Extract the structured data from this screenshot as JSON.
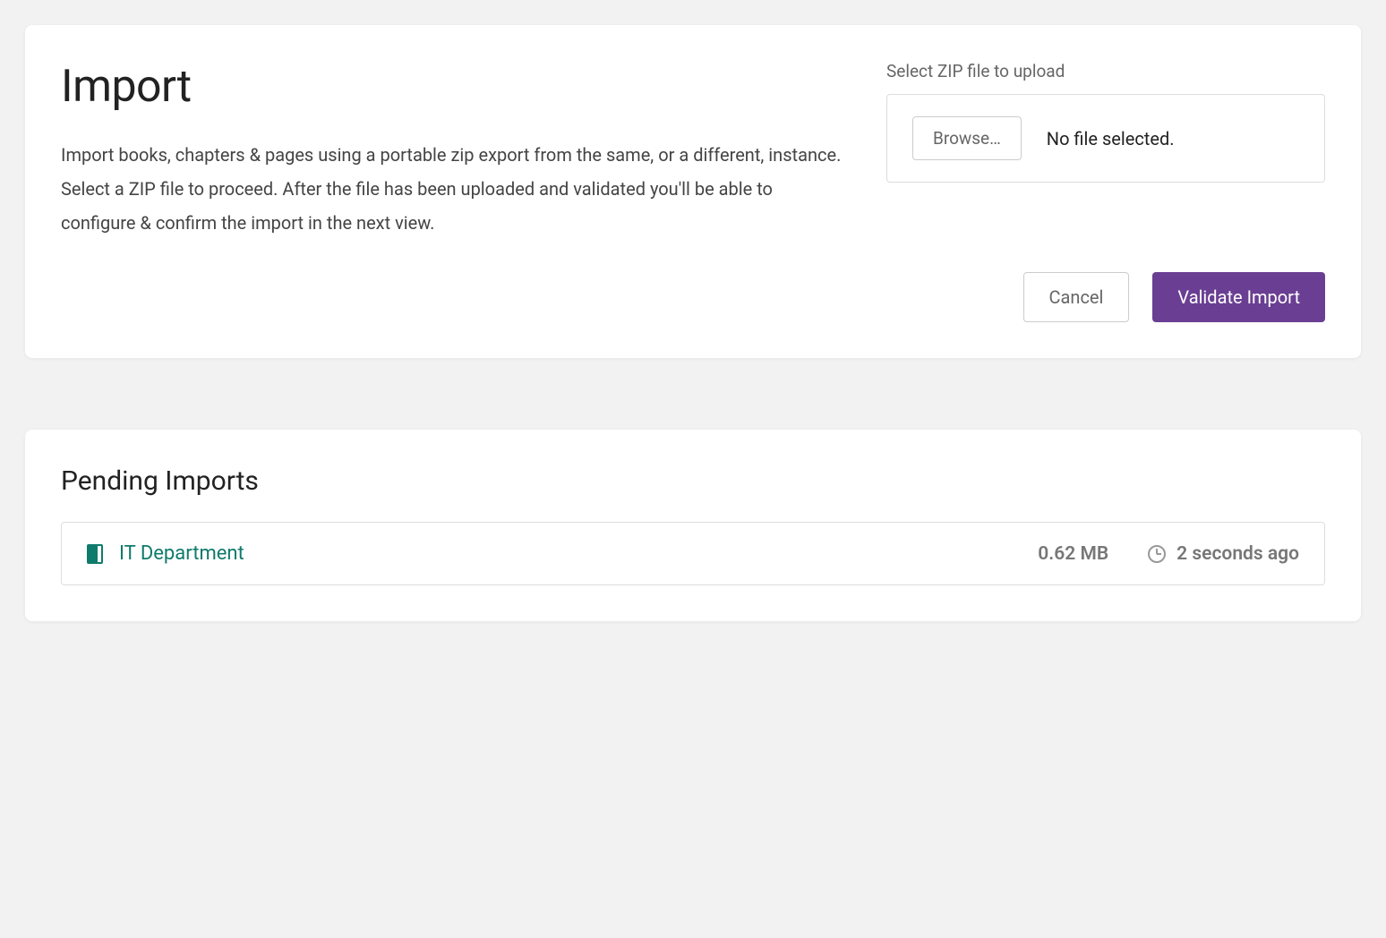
{
  "import_card": {
    "title": "Import",
    "description": "Import books, chapters & pages using a portable zip export from the same, or a different, instance. Select a ZIP file to proceed. After the file has been uploaded and validated you'll be able to configure & confirm the import in the next view.",
    "upload_label": "Select ZIP file to upload",
    "browse_label": "Browse…",
    "file_status": "No file selected.",
    "cancel_label": "Cancel",
    "validate_label": "Validate Import"
  },
  "pending_card": {
    "title": "Pending Imports",
    "items": [
      {
        "name": "IT Department",
        "size": "0.62 MB",
        "time": "2 seconds ago"
      }
    ]
  }
}
